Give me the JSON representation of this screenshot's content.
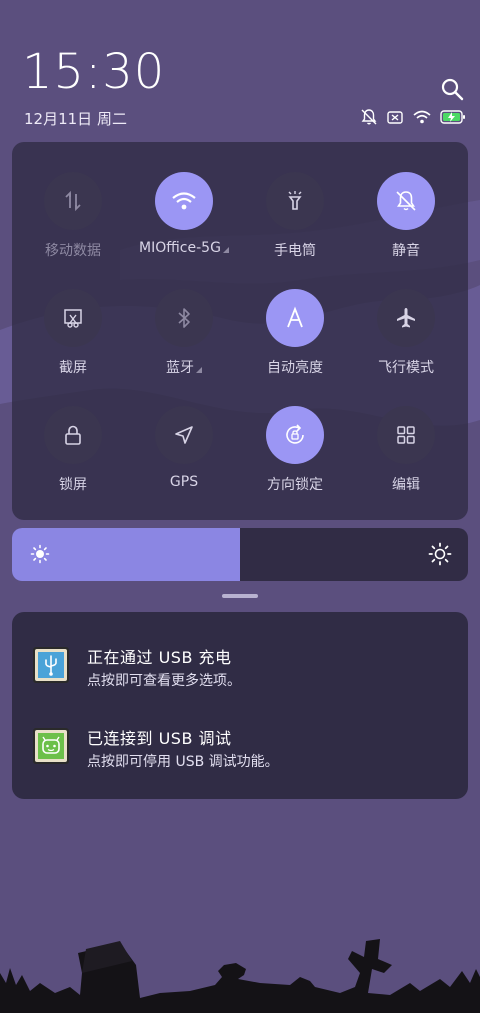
{
  "status": {
    "time": "15:30",
    "date": "12月11日 周二"
  },
  "quick_settings": [
    {
      "label": "移动数据",
      "icon": "mobile-data-icon",
      "active": false
    },
    {
      "label": "MIOffice-5G",
      "icon": "wifi-icon",
      "active": true
    },
    {
      "label": "手电筒",
      "icon": "flashlight-icon",
      "active": false
    },
    {
      "label": "静音",
      "icon": "mute-bell-icon",
      "active": true
    },
    {
      "label": "截屏",
      "icon": "screenshot-icon",
      "active": false
    },
    {
      "label": "蓝牙",
      "icon": "bluetooth-icon",
      "active": false
    },
    {
      "label": "自动亮度",
      "icon": "auto-brightness-icon",
      "active": true
    },
    {
      "label": "飞行模式",
      "icon": "airplane-icon",
      "active": false
    },
    {
      "label": "锁屏",
      "icon": "lock-icon",
      "active": false
    },
    {
      "label": "GPS",
      "icon": "gps-icon",
      "active": false
    },
    {
      "label": "方向锁定",
      "icon": "rotation-lock-icon",
      "active": true
    },
    {
      "label": "编辑",
      "icon": "edit-grid-icon",
      "active": false
    }
  ],
  "brightness": {
    "level": 0.5
  },
  "notifications": [
    {
      "title": "正在通过 USB 充电",
      "body": "点按即可查看更多选项。",
      "icon": "usb-icon",
      "icon_color": "#4aa3d8"
    },
    {
      "title": "已连接到 USB 调试",
      "body": "点按即可停用 USB 调试功能。",
      "icon": "android-debug-icon",
      "icon_color": "#6cc04a"
    }
  ],
  "colors": {
    "accent": "#9b96f4",
    "background": "#5b4f7e",
    "panel": "#302c45"
  }
}
